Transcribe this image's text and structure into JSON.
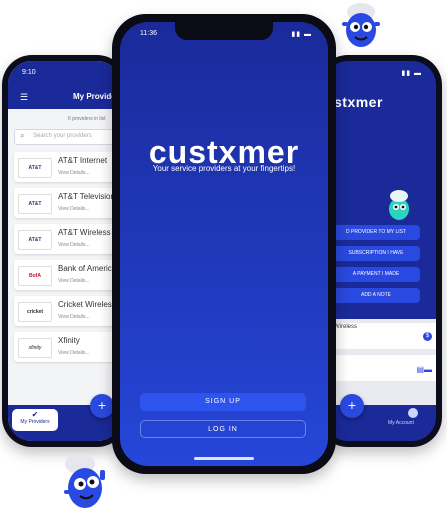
{
  "left_phone": {
    "status_time": "9:10",
    "header_title": "My Providers",
    "subtitle": "6 providers in list",
    "search_placeholder": "Search your providers",
    "providers": [
      {
        "name": "AT&T Internet",
        "logo": "AT&T",
        "details": "View Details..."
      },
      {
        "name": "AT&T Television",
        "logo": "AT&T",
        "details": "View Details..."
      },
      {
        "name": "AT&T Wireless",
        "logo": "AT&T",
        "details": "View Details..."
      },
      {
        "name": "Bank of America",
        "logo": "BofA",
        "details": "View Details..."
      },
      {
        "name": "Cricket Wireless",
        "logo": "cricket",
        "details": "View Details..."
      },
      {
        "name": "Xfinity",
        "logo": "xfinity",
        "details": "View Details..."
      }
    ],
    "fab": "+",
    "tab_active": "My Providers"
  },
  "center_phone": {
    "status_time": "11:36",
    "brand": "custxmer",
    "tagline": "Your service providers at your fingertips!",
    "signup": "SIGN UP",
    "login": "LOG IN"
  },
  "right_phone": {
    "brand": "stxmer",
    "buttons": [
      "D PROVIDER TO MY LIST",
      "SUBSCRIPTION I HAVE",
      "A PAYMENT I MADE",
      "ADD A NOTE"
    ],
    "row1": "Wireless",
    "fab": "+",
    "tab_account": "My Account"
  },
  "colors": {
    "primary": "#1b2a99",
    "accent": "#2a49e0",
    "mascot": "#2a49e0"
  }
}
